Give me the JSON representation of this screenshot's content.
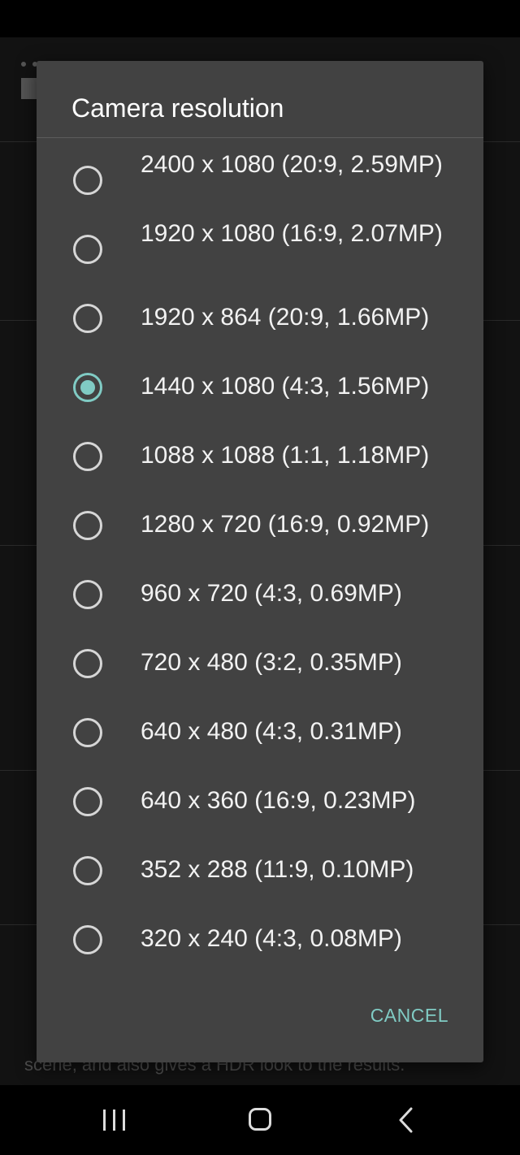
{
  "dialog": {
    "title": "Camera resolution",
    "options": [
      {
        "label": "2400 x 1080 (20:9, 2.59MP)",
        "checked": false
      },
      {
        "label": "1920 x 1080 (16:9, 2.07MP)",
        "checked": false
      },
      {
        "label": "1920 x 864 (20:9, 1.66MP)",
        "checked": false
      },
      {
        "label": "1440 x 1080 (4:3, 1.56MP)",
        "checked": true
      },
      {
        "label": "1088 x 1088 (1:1, 1.18MP)",
        "checked": false
      },
      {
        "label": "1280 x 720 (16:9, 0.92MP)",
        "checked": false
      },
      {
        "label": "960 x 720 (4:3, 0.69MP)",
        "checked": false
      },
      {
        "label": "720 x 480 (3:2, 0.35MP)",
        "checked": false
      },
      {
        "label": "640 x 480 (4:3, 0.31MP)",
        "checked": false
      },
      {
        "label": "640 x 360 (16:9, 0.23MP)",
        "checked": false
      },
      {
        "label": "352 x 288 (11:9, 0.10MP)",
        "checked": false
      },
      {
        "label": "320 x 240 (4:3, 0.08MP)",
        "checked": false
      }
    ],
    "cancel_label": "CANCEL"
  },
  "background": {
    "footer_text": "scene, and also gives a HDR look to the results."
  },
  "colors": {
    "accent": "#80cbc4",
    "dialog_bg": "#424242"
  },
  "nav": {
    "recents_icon": "recents-icon",
    "home_icon": "home-icon",
    "back_icon": "back-icon"
  }
}
